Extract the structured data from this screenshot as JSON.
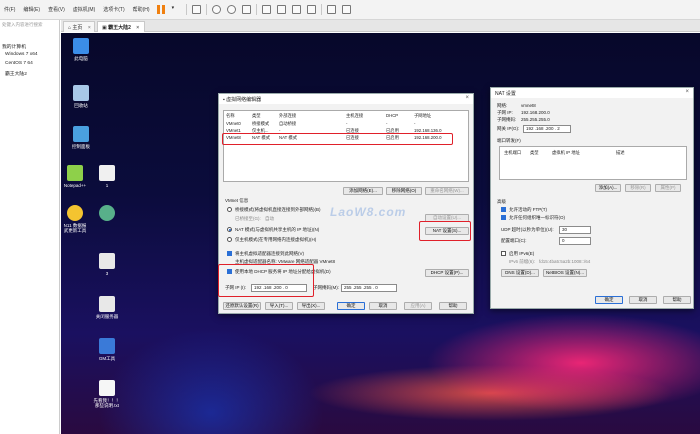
{
  "menubar": {
    "items": [
      "件(F)",
      "编辑(E)",
      "查看(V)",
      "虚拟机(M)",
      "选项卡(T)",
      "帮助(H)"
    ]
  },
  "library": {
    "search_placeholder": "处键入内容进行搜索",
    "items": [
      "我的计算机",
      "Windows 7 x64",
      "CentOS 7 64",
      "霸王大陆2"
    ]
  },
  "tabs": [
    {
      "label": "主页"
    },
    {
      "label": "霸王大陆2"
    }
  ],
  "desktop_icons": [
    {
      "label": "此电脑",
      "icon": "computer-icon"
    },
    {
      "label": "回收站",
      "icon": "recycle-bin-icon"
    },
    {
      "label": "控制面板",
      "icon": "control-panel-icon"
    },
    {
      "label": "Notepad++",
      "icon": "notepad-icon"
    },
    {
      "label": "N11 数据报\n武更新工具",
      "icon": "gear-icon"
    },
    {
      "label": "1",
      "icon": "file-icon"
    },
    {
      "label": "",
      "icon": "qr-icon"
    },
    {
      "label": "3",
      "icon": "gear-icon"
    },
    {
      "label": "关闭服务器",
      "icon": "gear-icon"
    },
    {
      "label": "GM工具",
      "icon": "gm-icon"
    },
    {
      "label": "先看我！！！\n那些说明.txt",
      "icon": "text-file-icon"
    }
  ],
  "vnet_dialog": {
    "title": "虚拟网络编辑器",
    "columns": [
      "名称",
      "类型",
      "外部连接",
      "主机连接",
      "DHCP",
      "子网地址"
    ],
    "rows": [
      [
        "VMnet0",
        "桥接模式",
        "自动桥接",
        "-",
        "-",
        "-"
      ],
      [
        "VMnet1",
        "仅主机...",
        "-",
        "已连接",
        "已启用",
        "192.168.136.0"
      ],
      [
        "VMnet8",
        "NAT 模式",
        "NAT 模式",
        "已连接",
        "已启用",
        "192.168.200.0"
      ]
    ],
    "add_network": "添加网络(E)...",
    "remove_network": "移除网络(O)",
    "rename_network": "重命名网络(W)...",
    "vmnet_info": "VMnet 信息",
    "bridged_radio": "桥接模式(将虚拟机直接连接到外部网络)(B)",
    "bridged_to": "已桥接至(G):",
    "bridged_auto": "自动",
    "auto_settings": "自动设置(U)...",
    "nat_radio": "NAT 模式(与虚拟机共享主机的 IP 地址)(N)",
    "nat_settings": "NAT 设置(S)...",
    "hostonly_radio": "仅主机模式(在专用网络内连接虚拟机)(H)",
    "connect_adapter": "将主机虚拟适配器连接到此网络(V)",
    "adapter_name": "主机虚拟适配器名称: VMware 网络适配器 VMnet8",
    "use_dhcp": "使用本地 DHCP 服务将 IP 地址分配给虚拟机(D)",
    "dhcp_settings": "DHCP 设置(P)...",
    "subnet_ip_label": "子网 IP (I):",
    "subnet_ip": "192 .168 .200 .  0",
    "subnet_mask_label": "子网掩码(M):",
    "subnet_mask": "255 .255 .255 .  0",
    "restore_defaults": "还原默认设置(R)",
    "import": "导入(T)...",
    "export": "导出(X)...",
    "ok": "确定",
    "cancel": "取消",
    "apply": "应用(A)",
    "help": "帮助"
  },
  "watermark": "LaoW8.com",
  "nat_dialog": {
    "title": "NAT 设置",
    "network_label": "网络:",
    "network_value": "vmnet8",
    "subnet_ip_label": "子网 IP:",
    "subnet_ip_value": "192.168.200.0",
    "subnet_mask_label": "子网掩码:",
    "subnet_mask_value": "255.255.255.0",
    "gateway_label": "网关 IP(G):",
    "gateway_value": "192 .168 .200 .  2",
    "port_forward_label": "端口转发(F)",
    "pf_columns": [
      "主机端口",
      "类型",
      "虚拟机 IP 地址",
      "描述"
    ],
    "add": "添加(A)...",
    "remove": "移除(R)",
    "properties": "属性(P)",
    "advanced": "高级",
    "allow_ftp": "允许活动的 FTP(T)",
    "allow_any_oui": "允许任何组织唯一标识符(O)",
    "udp_timeout_label": "UDP 超时(以秒为单位)(U):",
    "udp_timeout_value": "30",
    "config_port_label": "配置端口(C):",
    "config_port_value": "0",
    "enable_ipv6": "启用 IPv6(E)",
    "ipv6_prefix_label": "IPv6 前缀(6):",
    "ipv6_prefix_value": "fd15:4ba5:5a2b:1008::/64",
    "dns_settings": "DNS 设置(D)...",
    "netbios_settings": "NetBIOS 设置(N)...",
    "ok": "确定",
    "cancel": "取消",
    "help": "帮助"
  },
  "colors": {
    "highlight": "#e0202a",
    "accent": "#2a6fd6",
    "toolbar_pause": "#f08010"
  }
}
